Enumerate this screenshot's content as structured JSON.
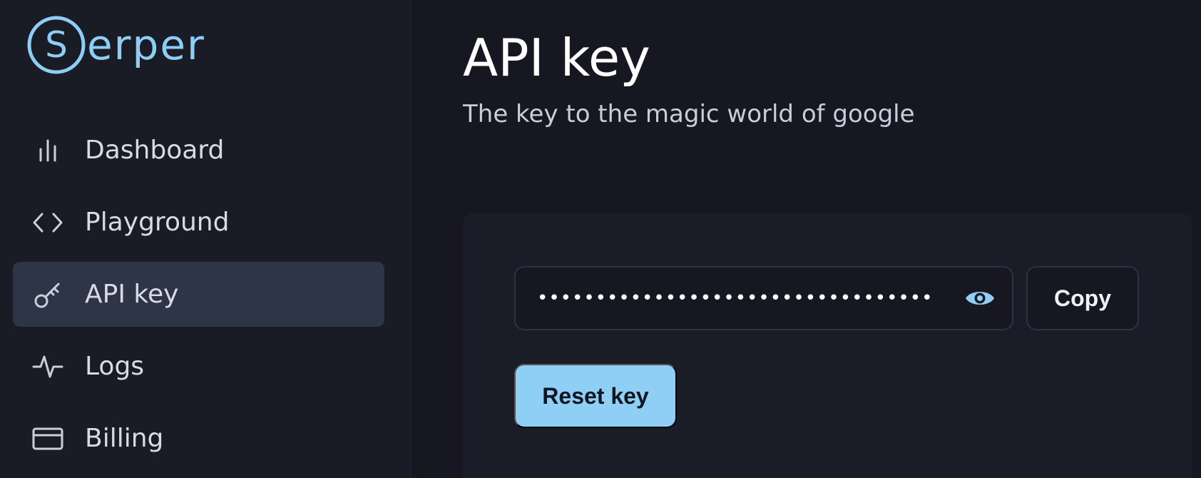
{
  "brand": {
    "name": "erper",
    "mark_letter": "S",
    "color": "#8ecdf5"
  },
  "sidebar": {
    "items": [
      {
        "label": "Dashboard",
        "icon": "bar-chart-icon",
        "active": false
      },
      {
        "label": "Playground",
        "icon": "code-brackets-icon",
        "active": false
      },
      {
        "label": "API key",
        "icon": "key-icon",
        "active": true
      },
      {
        "label": "Logs",
        "icon": "activity-icon",
        "active": false
      },
      {
        "label": "Billing",
        "icon": "credit-card-icon",
        "active": false
      }
    ]
  },
  "main": {
    "title": "API key",
    "subtitle": "The key to the magic world of google",
    "key_field": {
      "masked_value": "••••••••••••••••••••••••••••••••••",
      "toggle_icon": "eye-icon"
    },
    "copy_label": "Copy",
    "reset_label": "Reset key"
  },
  "colors": {
    "accent": "#8fcff5",
    "background": "#161720",
    "sidebar_bg": "#191b25",
    "active_item_bg": "#2e3547"
  }
}
